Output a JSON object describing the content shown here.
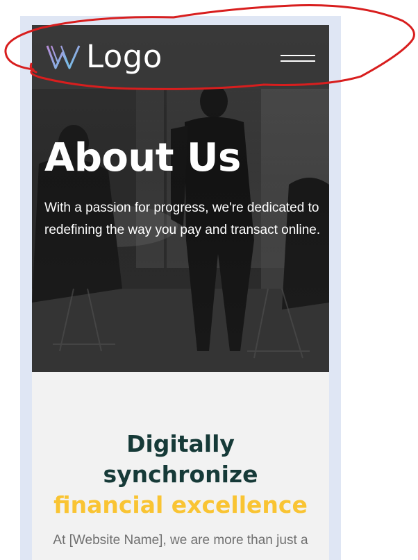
{
  "header": {
    "logo_text": "Logo",
    "menu_icon": "hamburger-menu-icon"
  },
  "hero": {
    "title": "About Us",
    "description": "With a passion for progress, we're dedicated to redefining the way you pay and transact online."
  },
  "section": {
    "headline_line1": "Digitally",
    "headline_line2": "synchronize",
    "headline_accent": "financial excellence",
    "intro": "At [Website Name], we are more than just a"
  },
  "colors": {
    "nav_bg": "#3a3a3a",
    "headline_dark": "#163a38",
    "headline_accent": "#f9c433",
    "body_text": "#6f6f6f",
    "annotation_red": "#d81e1e",
    "frame_bg": "#dfe6f4"
  },
  "icons": [
    "logo-w-mark-icon",
    "hamburger-menu-icon"
  ]
}
